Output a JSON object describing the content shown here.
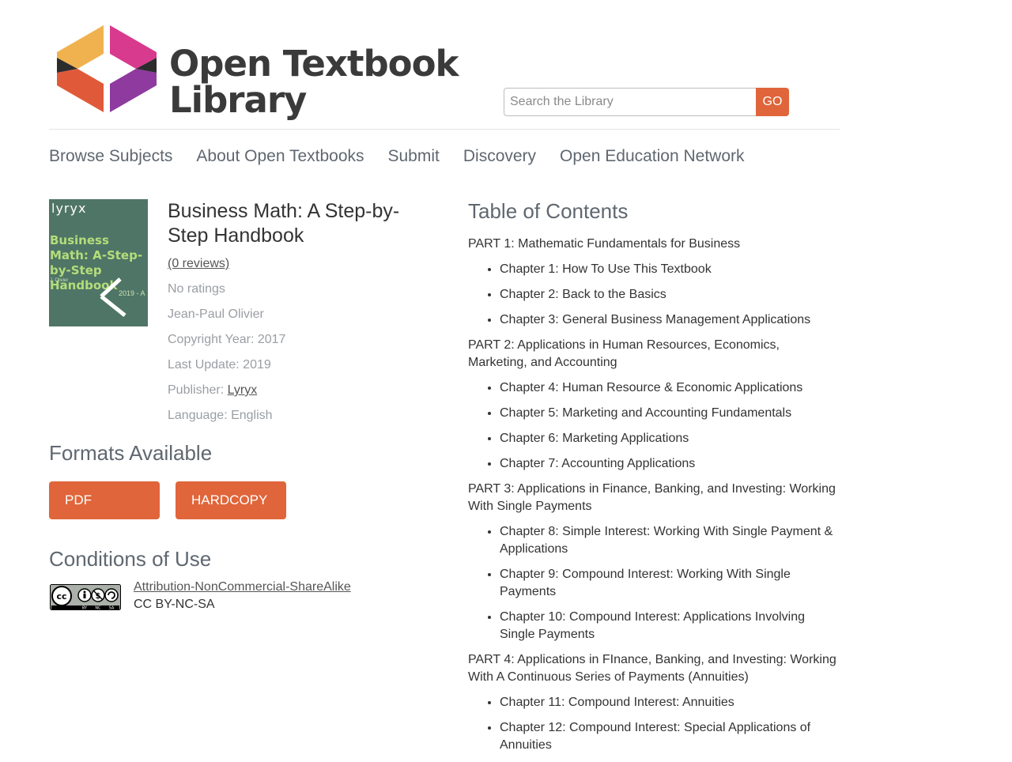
{
  "header": {
    "logo_line1": "Open Textbook",
    "logo_line2": "Library",
    "search_placeholder": "Search the Library",
    "search_button": "GO"
  },
  "nav": [
    "Browse Subjects",
    "About Open Textbooks",
    "Submit",
    "Discovery",
    "Open Education Network"
  ],
  "book": {
    "cover": {
      "brand": "lyryx",
      "title": "Business Math: A-Step-by-Step Handbook",
      "author": "J. Olivier",
      "year": "2019 - A"
    },
    "title": "Business Math: A Step-by-Step Handbook",
    "reviews": "(0 reviews)",
    "ratings": "No ratings",
    "author": "Jean-Paul Olivier",
    "copyright": "Copyright Year: 2017",
    "last_update": "Last Update: 2019",
    "publisher_label": "Publisher: ",
    "publisher": "Lyryx",
    "language": "Language: English"
  },
  "formats": {
    "heading": "Formats Available",
    "buttons": [
      "PDF",
      "HARDCOPY"
    ]
  },
  "conditions": {
    "heading": "Conditions of Use",
    "badge_icon": "cc-by-nc-sa-badge",
    "license_name": "Attribution-NonCommercial-ShareAlike",
    "license_code": "CC BY-NC-SA"
  },
  "toc": {
    "heading": "Table of Contents",
    "parts": [
      {
        "title": "PART 1: Mathematic Fundamentals for Business",
        "chapters": [
          "Chapter 1: How To Use This Textbook",
          "Chapter 2: Back to the Basics",
          "Chapter 3: General Business Management Applications"
        ]
      },
      {
        "title": "PART 2: Applications in Human Resources, Economics, Marketing, and Accounting",
        "chapters": [
          "Chapter 4: Human Resource & Economic Applications",
          "Chapter 5: Marketing and Accounting Fundamentals",
          "Chapter 6: Marketing Applications",
          "Chapter 7: Accounting Applications"
        ]
      },
      {
        "title": "PART 3: Applications in Finance, Banking, and Investing: Working With Single Payments",
        "chapters": [
          "Chapter 8: Simple Interest: Working With Single Payment & Applications",
          "Chapter 9: Compound Interest: Working With Single Payments",
          "Chapter 10: Compound Interest: Applications Involving Single Payments"
        ]
      },
      {
        "title": "PART 4: Applications in FInance, Banking, and Investing: Working With A Continuous Series of Payments (Annuities)",
        "chapters": [
          "Chapter 11: Compound Interest: Annuities",
          "Chapter 12: Compound Interest: Special Applications of Annuities"
        ]
      }
    ]
  },
  "colors": {
    "accent": "#e0653a",
    "logo_orange": "#f0b24f",
    "logo_pink": "#d83a8e",
    "logo_red": "#e05a3a",
    "logo_purple": "#8e3a9e",
    "cover_bg": "#4f7566"
  }
}
